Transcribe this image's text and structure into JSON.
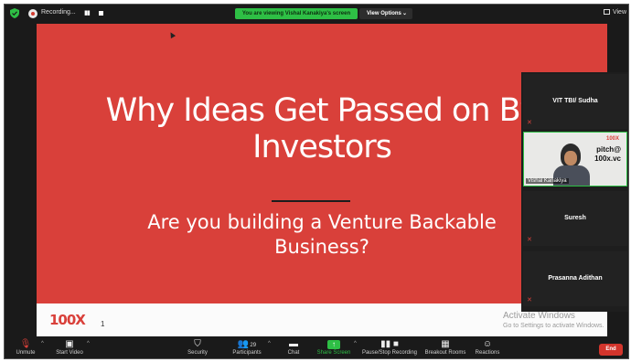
{
  "top_bar": {
    "recording_label": "Recording...",
    "pause_glyph": "▮▮",
    "viewing_banner": "You are viewing Vishal Kanakiya's screen",
    "view_options_label": "View Options",
    "view_options_caret": "⌄",
    "view_label": "View"
  },
  "slide": {
    "title_line1": "Why Ideas Get Passed on By",
    "title_line2": "Investors",
    "subtitle_line1": "Are you building a Venture Backable",
    "subtitle_line2": "Business?",
    "logo_text": "100X",
    "page_number": "1",
    "background_color": "#d9403a"
  },
  "watermark": {
    "line1": "Activate Windows",
    "line2": "Go to Settings to activate Windows."
  },
  "participants": [
    {
      "name": "VIT TBI/ Sudha",
      "muted": true,
      "video": false
    },
    {
      "name": "Vishal Kanakiya",
      "muted": false,
      "video": true,
      "wall_logo": "100X",
      "wall_text_1": "pitch@",
      "wall_text_2": "100x.vc"
    },
    {
      "name": "Suresh",
      "muted": true,
      "video": false
    },
    {
      "name": "Prasanna Adithan",
      "muted": true,
      "video": false
    }
  ],
  "toolbar": {
    "unmute": "Unmute",
    "start_video": "Start Video",
    "security": "Security",
    "participants": "Participants",
    "participant_count": "29",
    "chat": "Chat",
    "share_screen": "Share Screen",
    "pause_stop_recording": "Pause/Stop Recording",
    "breakout_rooms": "Breakout Rooms",
    "reactions": "Reactions",
    "end": "End"
  },
  "colors": {
    "accent_green": "#2ebf45",
    "end_red": "#d3352c"
  }
}
